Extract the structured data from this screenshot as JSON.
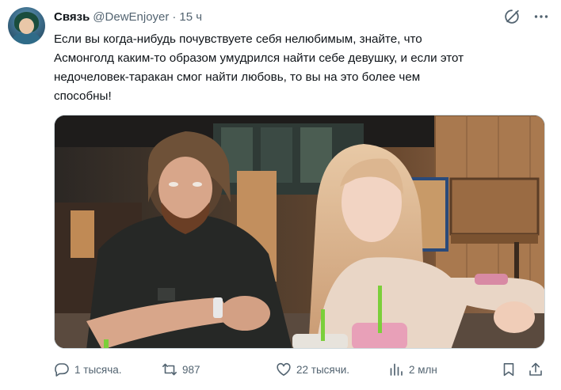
{
  "author": {
    "display_name": "Связь",
    "handle": "@DewEnjoyer",
    "separator": "·",
    "time": "15 ч"
  },
  "tweet": {
    "text_lines": [
      "Если вы когда-нибудь почувствуете себя нелюбимым, знайте, что",
      "Асмонголд каким-то образом умудрился найти себе девушку, и если этот",
      "недочеловек-таракан смог найти любовь, то вы на это более чем",
      "способны!"
    ]
  },
  "icons": {
    "grok": "grok-icon",
    "more": "more-icon",
    "reply": "reply-icon",
    "retweet": "retweet-icon",
    "like": "heart-icon",
    "views": "views-icon",
    "bookmark": "bookmark-icon",
    "share": "share-icon"
  },
  "stats": {
    "replies": "1 тысяча.",
    "retweets": "987",
    "likes": "22 тысячи.",
    "views": "2 млн"
  },
  "colors": {
    "text": "#0f1419",
    "secondary": "#536471",
    "border": "#cfd9de"
  }
}
